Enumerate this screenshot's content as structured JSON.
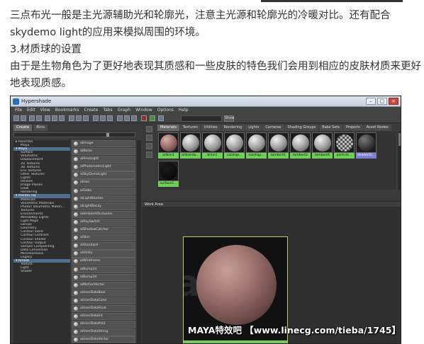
{
  "article": {
    "line1": "三点布光一般是主光源辅助光和轮廓光，注意主光源和轮廓光的冷暖对比。还有配合",
    "line2": "skydemo light的应用来模拟周围的环境。",
    "heading": "3.材质球的设置",
    "line3": "由于是生物角色为了更好地表现其质感和一些皮肤的特色我们会用到相应的皮肤材质来更好",
    "line4": "地表现质感。"
  },
  "window": {
    "title": "Hypershade",
    "minimize": "–",
    "maximize": "□",
    "close": "×"
  },
  "menu": [
    "File",
    "Edit",
    "View",
    "Bookmarks",
    "Create",
    "Tabs",
    "Graph",
    "Window",
    "Options",
    "Help"
  ],
  "toolbar": {
    "show_label": "Show"
  },
  "left_tabs": [
    "Create",
    "Bins"
  ],
  "tree": [
    {
      "label": "▸ Favorites",
      "level": 1
    },
    {
      "label": "Maya",
      "level": 2
    },
    {
      "label": "▾ Maya",
      "level": 1,
      "selected": true
    },
    {
      "label": "Surface",
      "level": 2
    },
    {
      "label": "Volumetric",
      "level": 2
    },
    {
      "label": "Displacement",
      "level": 2
    },
    {
      "label": "2D Textures",
      "level": 2
    },
    {
      "label": "3D Textures",
      "level": 2
    },
    {
      "label": "Env Textures",
      "level": 2
    },
    {
      "label": "Other Textures",
      "level": 2
    },
    {
      "label": "Lights",
      "level": 2
    },
    {
      "label": "Utilities",
      "level": 2
    },
    {
      "label": "Image Planes",
      "level": 2
    },
    {
      "label": "Glow",
      "level": 2
    },
    {
      "label": "Rendering",
      "level": 2
    },
    {
      "label": "▾ mental ray",
      "level": 1,
      "selected": true
    },
    {
      "label": "Materials",
      "level": 2
    },
    {
      "label": "Volumetric Materials",
      "level": 2
    },
    {
      "label": "Photon Volumetric Materi...",
      "level": 2
    },
    {
      "label": "Textures",
      "level": 2
    },
    {
      "label": "Environments",
      "level": 2
    },
    {
      "label": "MentalRay Lights",
      "level": 2
    },
    {
      "label": "Light Maps",
      "level": 2
    },
    {
      "label": "Lenses",
      "level": 2
    },
    {
      "label": "Geometry",
      "level": 2
    },
    {
      "label": "Contour Store",
      "level": 2
    },
    {
      "label": "Contour Contrast",
      "level": 2
    },
    {
      "label": "Contour Shader",
      "level": 2
    },
    {
      "label": "Contour Output",
      "level": 2
    },
    {
      "label": "Sample Compositing",
      "level": 2
    },
    {
      "label": "Data Conversion",
      "level": 2
    },
    {
      "label": "Miscellaneous",
      "level": 2
    },
    {
      "label": "Legacy",
      "level": 2
    },
    {
      "label": "▾ Arnold",
      "level": 1,
      "selected": true
    },
    {
      "label": "Texture",
      "level": 2
    },
    {
      "label": "Light",
      "level": 2
    },
    {
      "label": "Shader",
      "level": 2
    }
  ],
  "node_list": [
    "aiImage",
    "aiNoise",
    "aiAreaLight",
    "aiPhotometricLight",
    "aiSkyDomeLight",
    "aiHair",
    "aiGobo",
    "aiLightBlocker",
    "aiLightDecay",
    "aiAmbientOcclusion",
    "aiRaySwitch",
    "aiShadowCatcher",
    "aiSkin",
    "aiStandard",
    "aiUtility",
    "aiWireframe",
    "aiBump2d",
    "aiBump3d",
    "aiMotionVector",
    "aiUserDataBool",
    "aiUserDataColor",
    "aiUserDataFloat",
    "aiUserDataInt",
    "aiUserDataPnt2",
    "aiUserDataString",
    "aiUserDataVector"
  ],
  "right_tabs": [
    "Materials",
    "Textures",
    "Utilities",
    "Rendering",
    "Lights",
    "Cameras",
    "Shading Groups",
    "Bake Sets",
    "Projects",
    "Asset Nodes"
  ],
  "swatches": [
    {
      "label": "aiSkin1",
      "kind": "skin",
      "tag": "green"
    },
    {
      "label": "aiStanda...",
      "kind": "grey",
      "tag": "green"
    },
    {
      "label": "blinn1",
      "kind": "grey",
      "tag": "green"
    },
    {
      "label": "caizhigi...",
      "kind": "grey",
      "tag": "green"
    },
    {
      "label": "caizhigi...",
      "kind": "grey",
      "tag": "green"
    },
    {
      "label": "lambert1",
      "kind": "grey",
      "tag": "green"
    },
    {
      "label": "lambert2",
      "kind": "grey",
      "tag": "green"
    },
    {
      "label": "lambert4",
      "kind": "grey",
      "tag": "green"
    },
    {
      "label": "particle...",
      "kind": "checker",
      "tag": "green"
    },
    {
      "label": "shaderGl...",
      "kind": "dark",
      "tag": "blue"
    },
    {
      "label": "surface1...",
      "kind": "black",
      "tag": "green"
    }
  ],
  "work_area": {
    "title": "Work Area",
    "watermark_bg": "amo"
  },
  "watermark": "MAYA特效吧 【www.linecg.com/tieba/1745】"
}
